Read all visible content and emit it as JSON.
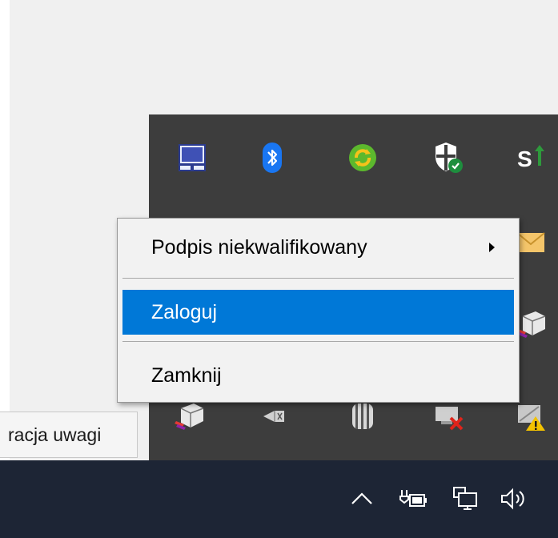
{
  "tooltip": {
    "text": "racja uwagi"
  },
  "context_menu": {
    "items": [
      {
        "label": "Podpis niekwalifikowany",
        "has_submenu": true
      },
      {
        "label": "Zaloguj",
        "selected": true
      },
      {
        "label": "Zamknij"
      }
    ]
  },
  "tray_overflow": {
    "icons": [
      "touchpad-icon",
      "bluetooth-icon",
      "sync-icon",
      "security-shield-icon",
      "signature-app-icon",
      "mail-icon",
      "printer-icon",
      "printer-icon",
      "usb-device-icon",
      "storage-icon",
      "network-disconnected-icon",
      "display-warning-icon"
    ]
  },
  "taskbar": {
    "icons": [
      "show-hidden-icons-chevron-icon",
      "power-icon",
      "network-icon",
      "volume-icon"
    ]
  },
  "colors": {
    "tray_background": "#3d3d3d",
    "taskbar_background": "#1d2535",
    "menu_background": "#f2f2f2",
    "menu_selected": "#0078d7"
  }
}
